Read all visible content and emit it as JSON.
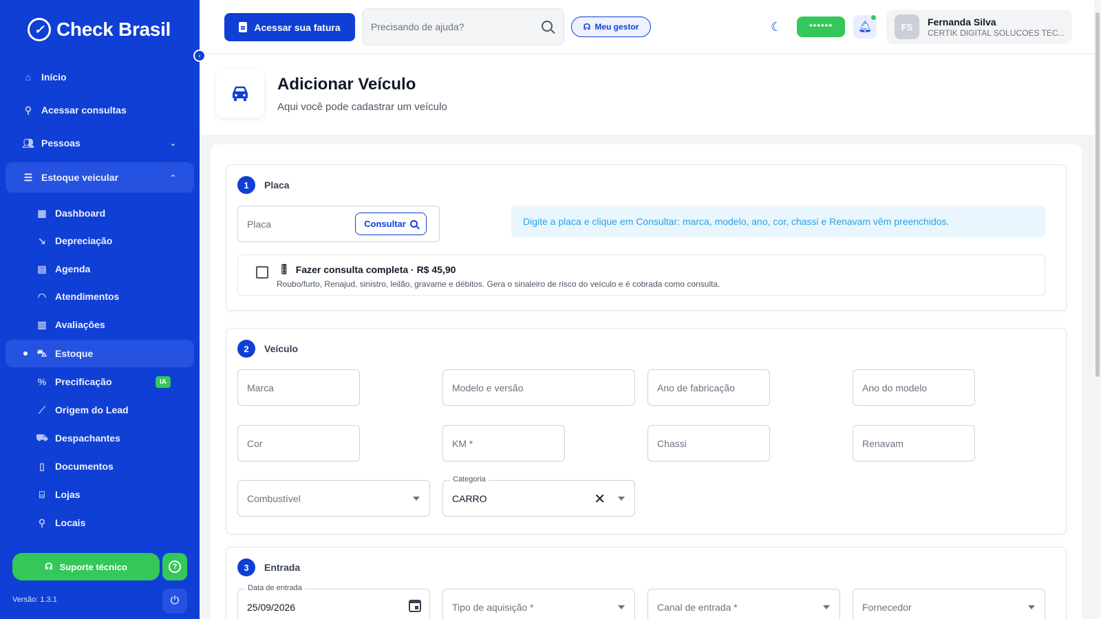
{
  "sidebar": {
    "brand": "Check Brasil",
    "items": [
      {
        "label": "Início",
        "icon": "home-icon"
      },
      {
        "label": "Acessar consultas",
        "icon": "search-icon"
      },
      {
        "label": "Pessoas",
        "icon": "people-icon"
      },
      {
        "label": "Estoque veicular",
        "icon": "garage-icon"
      }
    ],
    "subitems": [
      {
        "label": "Dashboard"
      },
      {
        "label": "Depreciação"
      },
      {
        "label": "Agenda"
      },
      {
        "label": "Atendimentos"
      },
      {
        "label": "Avaliações"
      },
      {
        "label": "Estoque"
      },
      {
        "label": "Precificação",
        "badge": "IA"
      },
      {
        "label": "Origem do Lead"
      },
      {
        "label": "Despachantes"
      },
      {
        "label": "Documentos"
      },
      {
        "label": "Lojas"
      },
      {
        "label": "Locais"
      }
    ],
    "support_label": "Suporte técnico",
    "version": "Versão: 1.3.1"
  },
  "header": {
    "invoice_label": "Acessar sua fatura",
    "search_placeholder": "Precisando de ajuda?",
    "manager_label": "Meu gestor",
    "password_mask": "******",
    "user": {
      "initials": "FS",
      "name": "Fernanda Silva",
      "org": "CERTIK DIGITAL SOLUCOES TEC..."
    }
  },
  "page": {
    "title": "Adicionar Veículo",
    "subtitle": "Aqui você pode cadastrar um veículo"
  },
  "sections": {
    "placa": {
      "number": "1",
      "title": "Placa",
      "plate_placeholder": "Placa",
      "consult_label": "Consultar",
      "info": "Digite a placa e clique em Consultar: marca, modelo, ano, cor, chassi e Renavam vêm preenchidos.",
      "full_check_title": "Fazer consulta completa · R$ 45,90",
      "full_check_desc": "Roubo/furto, Renajud, sinistro, leilão, gravame e débitos. Gera o sinaleiro de risco do veículo e é cobrada como consulta."
    },
    "veiculo": {
      "number": "2",
      "title": "Veículo",
      "marca": "Marca",
      "modelo": "Modelo e versão",
      "ano_fab": "Ano de fabricação",
      "ano_modelo": "Ano do modelo",
      "cor": "Cor",
      "km": "KM *",
      "chassi": "Chassi",
      "renavam": "Renavam",
      "combustivel": "Combustível",
      "categoria_label": "Categoria",
      "categoria_value": "CARRO"
    },
    "entrada": {
      "number": "3",
      "title": "Entrada",
      "data_label": "Data de entrada",
      "data_value": "25/09/2026",
      "tipo": "Tipo de aquisição *",
      "canal": "Canal de entrada *",
      "fornecedor": "Fornecedor"
    }
  },
  "colors": {
    "primary": "#0f3fd4",
    "success": "#34c759",
    "info_text": "#2da0e0"
  }
}
